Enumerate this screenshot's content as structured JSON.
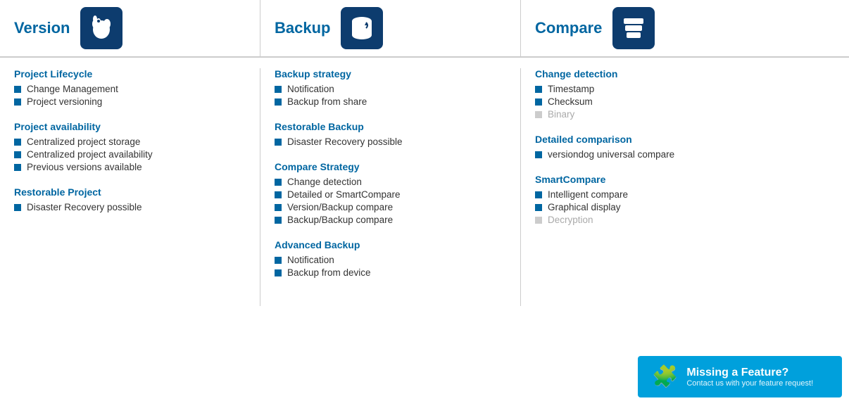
{
  "header": {
    "version": {
      "title": "Version",
      "icon_symbol": "🐕"
    },
    "backup": {
      "title": "Backup",
      "icon_symbol": "💾"
    },
    "compare": {
      "title": "Compare",
      "icon_symbol": "🗂"
    }
  },
  "version_sections": [
    {
      "title": "Project Lifecycle",
      "items": [
        {
          "label": "Change Management",
          "disabled": false
        },
        {
          "label": "Project versioning",
          "disabled": false
        }
      ]
    },
    {
      "title": "Project availability",
      "items": [
        {
          "label": "Centralized project storage",
          "disabled": false
        },
        {
          "label": "Centralized project availability",
          "disabled": false
        },
        {
          "label": "Previous versions available",
          "disabled": false
        }
      ]
    },
    {
      "title": "Restorable Project",
      "items": [
        {
          "label": "Disaster Recovery possible",
          "disabled": false
        }
      ]
    }
  ],
  "backup_sections": [
    {
      "title": "Backup strategy",
      "items": [
        {
          "label": "Notification",
          "disabled": false
        },
        {
          "label": "Backup from share",
          "disabled": false
        }
      ]
    },
    {
      "title": "Restorable Backup",
      "items": [
        {
          "label": "Disaster Recovery possible",
          "disabled": false
        }
      ]
    },
    {
      "title": "Compare Strategy",
      "items": [
        {
          "label": "Change detection",
          "disabled": false
        },
        {
          "label": "Detailed or SmartCompare",
          "disabled": false
        },
        {
          "label": "Version/Backup compare",
          "disabled": false
        },
        {
          "label": "Backup/Backup compare",
          "disabled": false
        }
      ]
    },
    {
      "title": "Advanced Backup",
      "items": [
        {
          "label": "Notification",
          "disabled": false
        },
        {
          "label": "Backup from device",
          "disabled": false
        }
      ]
    }
  ],
  "compare_sections": [
    {
      "title": "Change detection",
      "items": [
        {
          "label": "Timestamp",
          "disabled": false
        },
        {
          "label": "Checksum",
          "disabled": false
        },
        {
          "label": "Binary",
          "disabled": true
        }
      ]
    },
    {
      "title": "Detailed comparison",
      "items": [
        {
          "label": "versiondog universal compare",
          "disabled": false
        }
      ]
    },
    {
      "title": "SmartCompare",
      "items": [
        {
          "label": "Intelligent compare",
          "disabled": false
        },
        {
          "label": "Graphical display",
          "disabled": false
        },
        {
          "label": "Decryption",
          "disabled": true
        }
      ]
    }
  ],
  "missing_feature": {
    "title": "Missing a Feature?",
    "subtitle": "Contact us with your feature request!",
    "icon": "🧩"
  }
}
